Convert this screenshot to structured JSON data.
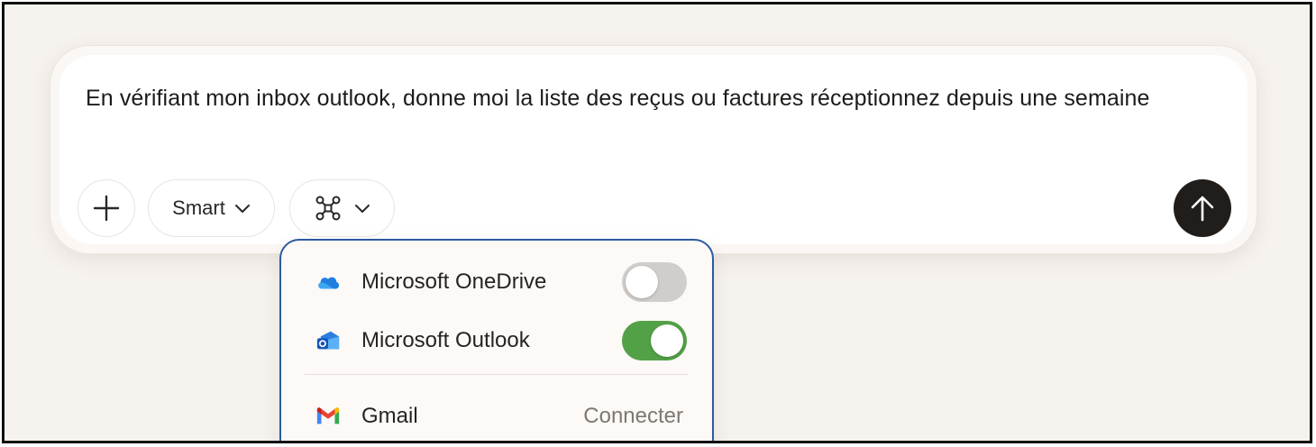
{
  "composer": {
    "prompt": "En vérifiant mon inbox outlook, donne moi la liste des reçus ou factures réceptionnez depuis une semaine",
    "mode_label": "Smart",
    "icons": {
      "add": "plus-icon",
      "mode_chevron": "chevron-down-icon",
      "tools": "connectors-icon",
      "tools_chevron": "chevron-down-icon",
      "send": "arrow-up-icon"
    }
  },
  "connectors": {
    "items": [
      {
        "label": "Microsoft OneDrive",
        "icon": "onedrive-icon",
        "enabled": false
      },
      {
        "label": "Microsoft Outlook",
        "icon": "outlook-icon",
        "enabled": true
      }
    ],
    "available": [
      {
        "label": "Gmail",
        "icon": "gmail-icon",
        "action": "Connecter"
      }
    ]
  },
  "colors": {
    "toggle_on": "#52a146",
    "toggle_off": "#d1cdca",
    "dropdown_border": "#2c5aa0",
    "send_button": "#201d1b"
  }
}
